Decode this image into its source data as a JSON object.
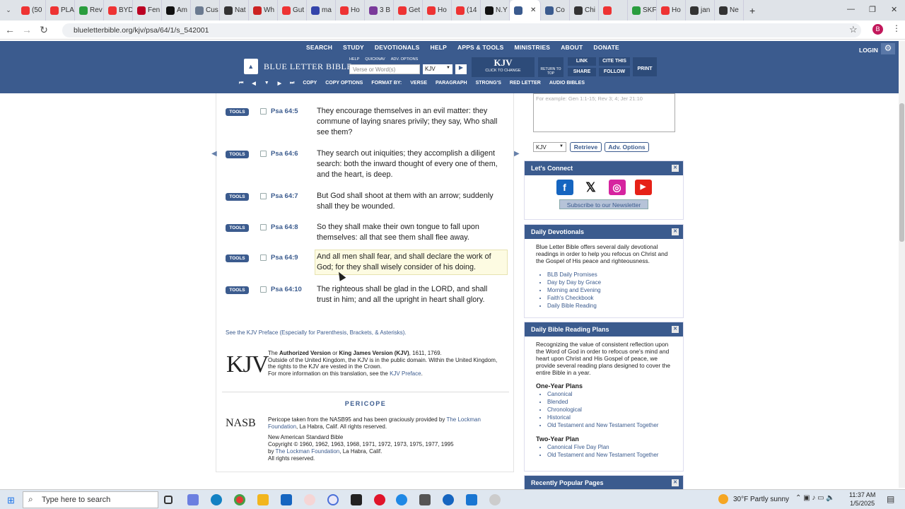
{
  "browser": {
    "tabs": [
      {
        "label": "(50",
        "color": "#e33"
      },
      {
        "label": "PLA",
        "color": "#e33"
      },
      {
        "label": "Rev",
        "color": "#2a9d3e"
      },
      {
        "label": "BYD",
        "color": "#e33"
      },
      {
        "label": "Fen",
        "color": "#b02"
      },
      {
        "label": "Am",
        "color": "#111"
      },
      {
        "label": "Cus",
        "color": "#6b7a90"
      },
      {
        "label": "Nat",
        "color": "#333"
      },
      {
        "label": "Wh",
        "color": "#c22"
      },
      {
        "label": "Gut",
        "color": "#e33"
      },
      {
        "label": "ma",
        "color": "#3344aa"
      },
      {
        "label": "Ho",
        "color": "#e33"
      },
      {
        "label": "3 B",
        "color": "#7a3a9a"
      },
      {
        "label": "Get",
        "color": "#e33"
      },
      {
        "label": "Ho",
        "color": "#e33"
      },
      {
        "label": "(14",
        "color": "#e33"
      },
      {
        "label": "N.Y",
        "color": "#111"
      },
      {
        "label": "",
        "color": "#3b5b8e"
      },
      {
        "label": "Co",
        "color": "#3b5b8e"
      },
      {
        "label": "Chi",
        "color": "#333"
      },
      {
        "label": "",
        "color": "#e33"
      },
      {
        "label": "SKF",
        "color": "#2a9d3e"
      },
      {
        "label": "Ho",
        "color": "#e33"
      },
      {
        "label": "jan",
        "color": "#333"
      },
      {
        "label": "Ne",
        "color": "#333"
      }
    ],
    "url": "blueletterbible.org/kjv/psa/64/1/s_542001",
    "avatar_letter": "B"
  },
  "site": {
    "menu": [
      "SEARCH",
      "STUDY",
      "DEVOTIONALS",
      "HELP",
      "APPS & TOOLS",
      "MINISTRIES",
      "ABOUT",
      "DONATE"
    ],
    "login": "LOGIN",
    "logo_text": "BLUE LETTER BIBLE",
    "search_options": [
      "HELP",
      "QUICKNAV",
      "ADV. OPTIONS"
    ],
    "search_placeholder": "Verse or Word(s)",
    "version": "KJV",
    "version_caption": "CLICK TO CHANGE",
    "return_label": "RETURN TO TOP",
    "link": "LINK",
    "share": "SHARE",
    "cite": "CITE THIS",
    "follow": "FOLLOW",
    "print": "PRINT",
    "subbar": [
      "COPY",
      "COPY OPTIONS",
      "FORMAT BY:",
      "VERSE",
      "PARAGRAPH",
      "STRONG'S",
      "RED LETTER",
      "AUDIO BIBLES"
    ]
  },
  "verses": [
    {
      "tools": "TOOLS",
      "ref": "Psa 64:5",
      "text": "They encourage themselves in an evil matter: they commune of laying snares privily; they say, Who shall see them?"
    },
    {
      "tools": "TOOLS",
      "ref": "Psa 64:6",
      "text": "They search out iniquities; they accomplish a diligent search: both the inward thought of every one of them, and the heart, is deep."
    },
    {
      "tools": "TOOLS",
      "ref": "Psa 64:7",
      "text": "But God shall shoot at them with an arrow; suddenly shall they be wounded."
    },
    {
      "tools": "TOOLS",
      "ref": "Psa 64:8",
      "text": "So they shall make their own tongue to fall upon themselves: all that see them shall flee away."
    },
    {
      "tools": "TOOLS",
      "ref": "Psa 64:9",
      "text": "And all men shall fear, and shall declare the work of God; for they shall wisely consider of his doing."
    },
    {
      "tools": "TOOLS",
      "ref": "Psa 64:10",
      "text": "The righteous shall be glad in the LORD, and shall trust in him; and all the upright in heart shall glory."
    }
  ],
  "preface_link": "See the KJV Preface (Especially for Parenthesis, Brackets, & Asterisks).",
  "kjv_logo": "KJV",
  "kjv_info": {
    "line1_pre": "The ",
    "line1_b1": "Authorized Version",
    "line1_mid": " or ",
    "line1_b2": "King James Version (KJV)",
    "line1_post": ", 1611, 1769.",
    "line2": "Outside of the United Kingdom, the KJV is in the public domain. Within the United Kingdom, the rights to the KJV are vested in the Crown.",
    "line3_pre": "For more information on this translation, see the ",
    "line3_link": "KJV Preface",
    "line3_post": "."
  },
  "pericope_heading": "PERICOPE",
  "nasb_logo": "NASB",
  "nasb_info": {
    "p1_pre": "Pericope taken from the NASB95 and has been graciously provided by ",
    "p1_link": "The Lockman Foundation",
    "p1_post": ", La Habra, Calif. All rights reserved.",
    "p2_l1": "New American Standard Bible",
    "p2_l2": "Copyright © 1960, 1962, 1963, 1968, 1971, 1972, 1973, 1975, 1977, 1995",
    "p2_l3_pre": "by ",
    "p2_l3_link": "The Lockman Foundation",
    "p2_l3_post": ", La Habra, Calif.",
    "p2_l4": "All rights reserved."
  },
  "sidebar": {
    "example_placeholder": "For example: Gen 1:1-15; Rev 3; 4; Jer 21:10",
    "version": "KJV",
    "retrieve": "Retrieve",
    "adv_options": "Adv. Options",
    "connect_title": "Let's Connect",
    "newsletter": "Subscribe to our Newsletter",
    "devotionals_title": "Daily Devotionals",
    "devotionals_text": "Blue Letter Bible offers several daily devotional readings in order to help you refocus on Christ and the Gospel of His peace and righteousness.",
    "devotionals": [
      "BLB Daily Promises",
      "Day by Day by Grace",
      "Morning and Evening",
      "Faith's Checkbook",
      "Daily Bible Reading"
    ],
    "plans_title": "Daily Bible Reading Plans",
    "plans_text": "Recognizing the value of consistent reflection upon the Word of God in order to refocus one's mind and heart upon Christ and His Gospel of peace, we provide several reading plans designed to cover the entire Bible in a year.",
    "one_year_title": "One-Year Plans",
    "one_year": [
      "Canonical",
      "Blended",
      "Chronological",
      "Historical",
      "Old Testament and New Testament Together"
    ],
    "two_year_title": "Two-Year Plan",
    "two_year": [
      "Canonical Five Day Plan",
      "Old Testament and New Testament Together"
    ],
    "popular_title": "Recently Popular Pages"
  },
  "taskbar": {
    "search_placeholder": "Type here to search",
    "weather": "30°F  Partly sunny",
    "time": "11:37 AM",
    "date": "1/5/2025"
  }
}
